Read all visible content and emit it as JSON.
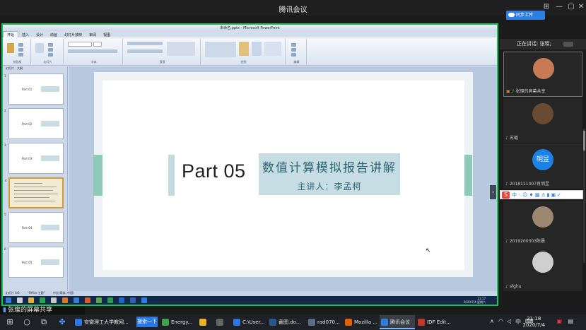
{
  "window": {
    "title": "腾讯会议",
    "upload_label": "同步上传"
  },
  "shared_screen": {
    "share_label": "张璨的屏幕共享",
    "ppt": {
      "doc_title": "未命名.pptx - Microsoft PowerPoint",
      "tabs": [
        "开始",
        "插入",
        "设计",
        "动画",
        "幻灯片放映",
        "审阅",
        "视图"
      ],
      "ribbon_groups": [
        "剪贴板",
        "幻灯片",
        "字体",
        "段落",
        "绘图",
        "编辑"
      ],
      "panel_tabs": [
        "幻灯片",
        "大纲"
      ],
      "thumbnails": [
        {
          "num": "1",
          "title": "Part 01"
        },
        {
          "num": "2",
          "title": "Part 02"
        },
        {
          "num": "3",
          "title": "Part 03"
        },
        {
          "num": "4",
          "title": ""
        },
        {
          "num": "5",
          "title": "Part 04"
        },
        {
          "num": "6",
          "title": "Part 05"
        }
      ],
      "status": [
        "幻灯片 6/6",
        "\"Office 主题\"",
        "中文(简体, 中国)"
      ],
      "slide": {
        "part": "Part 05",
        "topic": "数值计算模拟报告讲解",
        "speaker": "主讲人：李孟柯"
      },
      "inner_clock": {
        "time": "21:17",
        "date": "2020/7/4 星期六"
      }
    }
  },
  "participants": {
    "speaking_label": "正在讲话: 张璨;",
    "list": [
      {
        "name": "张璨的屏幕共享",
        "avatar": "photo",
        "avatar_color": "#c77a54"
      },
      {
        "name": "苏璐",
        "avatar": "photo",
        "avatar_color": "#6a4a30"
      },
      {
        "name": "2018111407肖明昱",
        "avatar": "text",
        "avatar_text": "明昱"
      },
      {
        "name": "2019200303陈晨",
        "avatar": "photo",
        "avatar_color": "#9c8870"
      },
      {
        "name": "sfghu",
        "avatar": "default",
        "avatar_color": "#cfcfcf"
      }
    ]
  },
  "taskbar": {
    "apps": [
      {
        "label": "安徽理工大学教网...",
        "color": "#2b78e4"
      },
      {
        "label": "Energy...",
        "color": "#3da34d"
      },
      {
        "label": "",
        "color": "#e6b422"
      },
      {
        "label": "",
        "color": "#666"
      },
      {
        "label": "C:\\User...",
        "color": "#2b78e4"
      },
      {
        "label": "截图.do...",
        "color": "#2b5797"
      },
      {
        "label": "rad070...",
        "color": "#5b6d86"
      },
      {
        "label": "Mozilla ...",
        "color": "#e66000"
      },
      {
        "label": "腾讯会议",
        "color": "#2f7de0"
      },
      {
        "label": "IDF Edit...",
        "color": "#c0392b"
      }
    ],
    "search_label": "搜索一下",
    "tray": {
      "ime": "中",
      "time": "21:18",
      "date": "2020/7/4"
    }
  }
}
